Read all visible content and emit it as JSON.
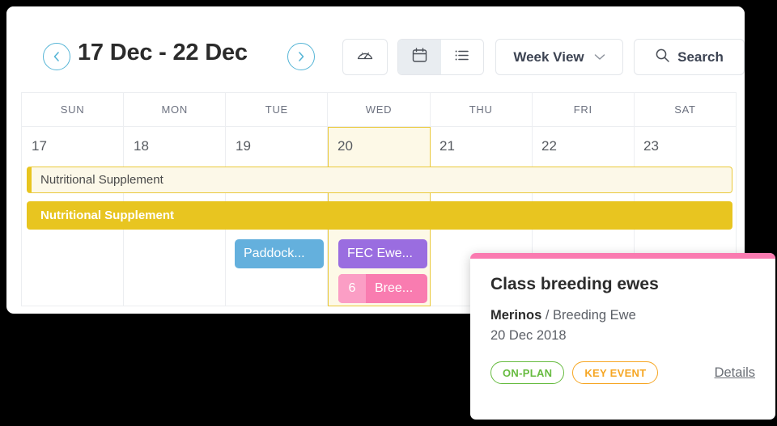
{
  "toolbar": {
    "date_range": "17 Dec - 22 Dec",
    "prev_icon": "chevron-left-icon",
    "next_icon": "chevron-right-icon",
    "dashboard_icon": "gauge-icon",
    "calendar_icon": "calendar-icon",
    "list_icon": "list-icon",
    "view_select_label": "Week View",
    "view_select_chevron": "chevron-down-icon",
    "search_label": "Search",
    "search_icon": "search-icon"
  },
  "calendar": {
    "day_headers": [
      "SUN",
      "MON",
      "TUE",
      "WED",
      "THU",
      "FRI",
      "SAT"
    ],
    "day_numbers": [
      "17",
      "18",
      "19",
      "20",
      "21",
      "22",
      "23"
    ],
    "today_index": 3,
    "span_events": [
      {
        "label": "Nutritional Supplement",
        "style": "light"
      },
      {
        "label": "Nutritional Supplement",
        "style": "solid"
      }
    ],
    "chips": [
      {
        "label": "Paddock...",
        "color": "#64b0dd",
        "day": "TUE"
      },
      {
        "label": "FEC Ewe...",
        "color": "#9a6de0",
        "day": "WED"
      },
      {
        "label": "Bree...",
        "count": "6",
        "color": "#f97cb0",
        "day": "WED"
      }
    ]
  },
  "popover": {
    "title": "Class breeding ewes",
    "mob": "Merinos",
    "separator": " / ",
    "class": "Breeding Ewe",
    "date": "20 Dec 2018",
    "status_pill": "ON-PLAN",
    "key_event_pill": "KEY EVENT",
    "details_link": "Details",
    "accent_color": "#fa7ab0"
  },
  "colors": {
    "accent_blue": "#56b5d6",
    "event_yellow": "#e8c520",
    "today_fill": "#fdf9e7",
    "on_plan_green": "#66bb3f",
    "key_event_orange": "#f6a623"
  }
}
